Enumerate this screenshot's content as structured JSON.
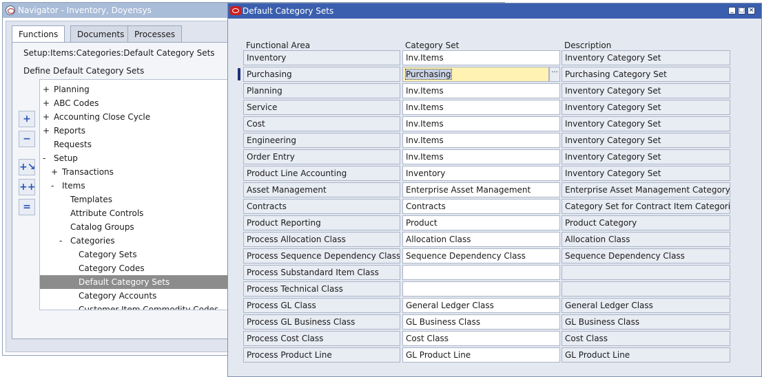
{
  "navigator": {
    "title": "Navigator - Inventory, Doyensys",
    "tabs": [
      "Functions",
      "Documents",
      "Processes"
    ],
    "path": "Setup:Items:Categories:Default Category Sets",
    "heading": "Define Default Category Sets",
    "tree": [
      {
        "prefix": "+",
        "label": "Planning",
        "level": 0
      },
      {
        "prefix": "+",
        "label": "ABC Codes",
        "level": 0
      },
      {
        "prefix": "+",
        "label": "Accounting Close Cycle",
        "level": 0
      },
      {
        "prefix": "+",
        "label": "Reports",
        "level": 0
      },
      {
        "prefix": "",
        "label": "Requests",
        "level": 0
      },
      {
        "prefix": "-",
        "label": "Setup",
        "level": 0
      },
      {
        "prefix": "+",
        "label": "Transactions",
        "level": 1
      },
      {
        "prefix": "-",
        "label": "Items",
        "level": 1
      },
      {
        "prefix": "",
        "label": "Templates",
        "level": 2
      },
      {
        "prefix": "",
        "label": "Attribute Controls",
        "level": 2
      },
      {
        "prefix": "",
        "label": "Catalog Groups",
        "level": 2
      },
      {
        "prefix": "-",
        "label": "Categories",
        "level": 2
      },
      {
        "prefix": "",
        "label": "Category Sets",
        "level": 3
      },
      {
        "prefix": "",
        "label": "Category Codes",
        "level": 3
      },
      {
        "prefix": "",
        "label": "Default Category Sets",
        "level": 3,
        "selected": true
      },
      {
        "prefix": "",
        "label": "Category Accounts",
        "level": 3
      },
      {
        "prefix": "",
        "label": "Customer Item Commodity Codes",
        "level": 3
      }
    ],
    "buttons": [
      {
        "name": "expand-button",
        "glyph": "+"
      },
      {
        "name": "collapse-button",
        "glyph": "−"
      },
      {
        "name": "expand-branch-button",
        "glyph": "+↘"
      },
      {
        "name": "expand-all-button",
        "glyph": "++"
      },
      {
        "name": "collapse-all-button",
        "glyph": "="
      }
    ]
  },
  "dcs": {
    "title": "Default Category Sets",
    "columns": {
      "functional_area": "Functional Area",
      "category_set": "Category Set",
      "description": "Description"
    },
    "rows": [
      {
        "area": "Inventory",
        "set": "Inv.Items",
        "desc": "Inventory Category Set"
      },
      {
        "area": "Purchasing",
        "set": "Purchasing",
        "desc": "Purchasing Category Set",
        "current": true
      },
      {
        "area": "Planning",
        "set": "Inv.Items",
        "desc": "Inventory Category Set"
      },
      {
        "area": "Service",
        "set": "Inv.Items",
        "desc": "Inventory Category Set"
      },
      {
        "area": "Cost",
        "set": "Inv.Items",
        "desc": "Inventory Category Set"
      },
      {
        "area": "Engineering",
        "set": "Inv.Items",
        "desc": "Inventory Category Set"
      },
      {
        "area": "Order Entry",
        "set": "Inv.Items",
        "desc": "Inventory Category Set"
      },
      {
        "area": "Product Line Accounting",
        "set": "Inventory",
        "desc": "Inventory Category Set"
      },
      {
        "area": "Asset Management",
        "set": "Enterprise Asset Management",
        "desc": "Enterprise Asset Management Category S"
      },
      {
        "area": "Contracts",
        "set": "Contracts",
        "desc": "Category Set for Contract Item Categories"
      },
      {
        "area": "Product Reporting",
        "set": "Product",
        "desc": "Product Category"
      },
      {
        "area": "Process Allocation Class",
        "set": "Allocation Class",
        "desc": "Allocation Class"
      },
      {
        "area": "Process Sequence Dependency Class",
        "set": "Sequence Dependency Class",
        "desc": "Sequence Dependency Class"
      },
      {
        "area": "Process Substandard Item Class",
        "set": "",
        "desc": ""
      },
      {
        "area": "Process Technical Class",
        "set": "",
        "desc": ""
      },
      {
        "area": "Process GL Class",
        "set": "General Ledger Class",
        "desc": "General Ledger Class"
      },
      {
        "area": "Process GL Business Class",
        "set": "GL Business Class",
        "desc": "GL Business Class"
      },
      {
        "area": "Process Cost Class",
        "set": "Cost Class",
        "desc": "Cost Class"
      },
      {
        "area": "Process Product Line",
        "set": "GL Product Line",
        "desc": "GL Product Line"
      }
    ],
    "lov_glyph": "···"
  }
}
